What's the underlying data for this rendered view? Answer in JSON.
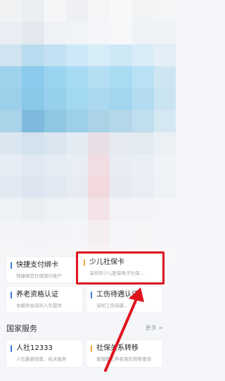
{
  "services_grid": [
    {
      "title": "快捷支付绑卡",
      "subtitle": "快捷绑定社保银行账户",
      "accent": "#3b7be0"
    },
    {
      "title": "少儿社保卡",
      "subtitle": "深圳市少儿医保电子社保…",
      "accent": "#f2a93b"
    },
    {
      "title": "养老资格认证",
      "subtitle": "本服务由深圳人社提供",
      "accent": "#3b7be0"
    },
    {
      "title": "工伤待遇认证",
      "subtitle": "深圳工伤待遇…",
      "accent": "#3b7be0"
    }
  ],
  "national_section": {
    "title": "国家服务",
    "more_label": "更多 >",
    "items": [
      {
        "title": "人社12333",
        "subtitle": "人社最新政策、机关服务",
        "accent": "#3b7be0"
      },
      {
        "title": "社保关系转移",
        "subtitle": "城镇职工养老保险转移查询",
        "accent": "#f2a93b"
      }
    ]
  },
  "annotation": {
    "highlight_color": "#e0141e",
    "arrow_color": "#e0141e"
  }
}
